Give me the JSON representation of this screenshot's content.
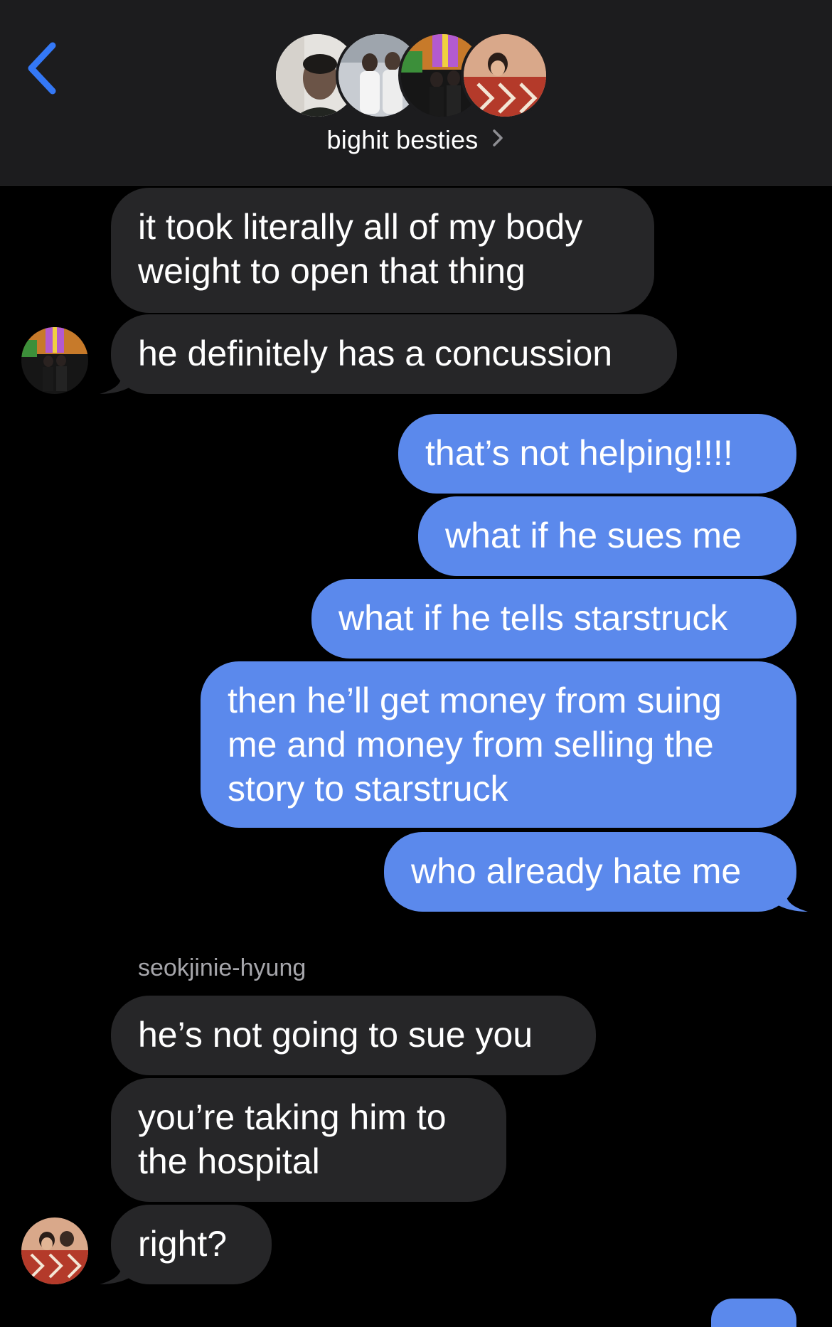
{
  "header": {
    "group_name": "bighit besties",
    "chevron": "›"
  },
  "colors": {
    "header_bg": "#1c1c1e",
    "received_bubble": "#262628",
    "sent_bubble": "#5b89ec",
    "accent": "#3478f6"
  },
  "messages": [
    {
      "side": "received",
      "text": "it took literally all of my body\nweight to open that thing"
    },
    {
      "side": "received",
      "text": "he definitely has a concussion"
    },
    {
      "side": "sent",
      "text": "that’s not helping!!!!"
    },
    {
      "side": "sent",
      "text": "what if he sues me"
    },
    {
      "side": "sent",
      "text": "what if he tells starstruck"
    },
    {
      "side": "sent",
      "text": "then he’ll get money from suing\nme and money from selling the\nstory to starstruck"
    },
    {
      "side": "sent",
      "text": "who already hate me"
    },
    {
      "side": "received",
      "text": "he’s not going to sue you"
    },
    {
      "side": "received",
      "text": "you’re taking him to\nthe hospital"
    },
    {
      "side": "received",
      "text": "right?"
    }
  ],
  "sender_label": "seokjinie-hyung",
  "icons": {
    "back": "chevron-left-icon",
    "header_chevron": "chevron-right-icon"
  }
}
